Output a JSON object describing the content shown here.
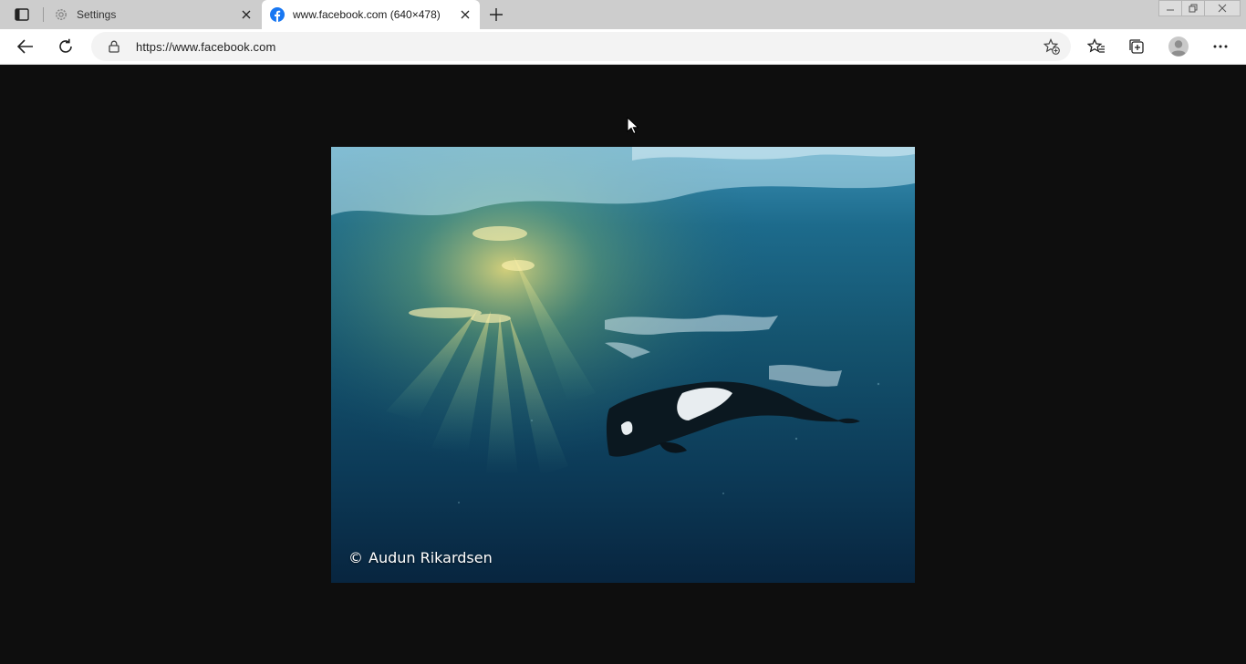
{
  "tabs": [
    {
      "title": "Settings",
      "icon": "gear-icon",
      "active": false
    },
    {
      "title": "www.facebook.com (640×478)",
      "icon": "facebook-icon",
      "active": true
    }
  ],
  "address_bar": {
    "url": "https://www.facebook.com"
  },
  "image": {
    "credit": "Audun Rikardsen",
    "credit_symbol": "©",
    "dimensions": "640×478"
  },
  "colors": {
    "facebook_blue": "#1877f2",
    "page_background": "#0e0e0e"
  }
}
